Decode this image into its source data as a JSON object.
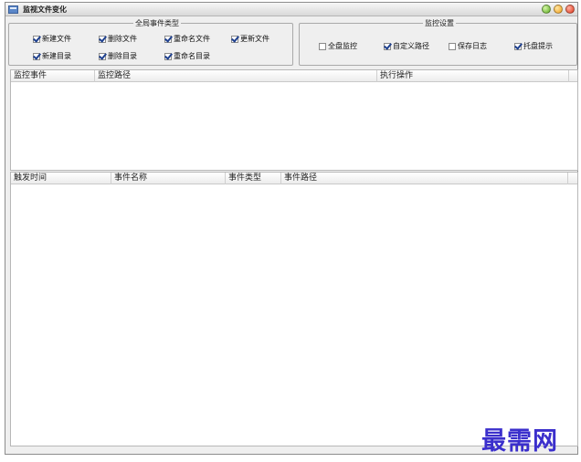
{
  "window": {
    "title": "监视文件变化",
    "accent": "#5b87c9"
  },
  "events_group": {
    "caption": "全局事件类型",
    "options": [
      {
        "label": "新建文件",
        "checked": true
      },
      {
        "label": "删除文件",
        "checked": true
      },
      {
        "label": "重命名文件",
        "checked": true
      },
      {
        "label": "更新文件",
        "checked": true
      },
      {
        "label": "新建目录",
        "checked": true
      },
      {
        "label": "删除目录",
        "checked": true
      },
      {
        "label": "重命名目录",
        "checked": true
      }
    ]
  },
  "settings_group": {
    "caption": "监控设置",
    "options": [
      {
        "label": "全盘监控",
        "checked": false
      },
      {
        "label": "自定义路径",
        "checked": true
      },
      {
        "label": "保存日志",
        "checked": false
      },
      {
        "label": "托盘提示",
        "checked": true
      }
    ]
  },
  "monitor_table": {
    "columns": [
      "监控事件",
      "监控路径",
      "执行操作"
    ],
    "rows": []
  },
  "log_table": {
    "columns": [
      "触发时间",
      "事件名称",
      "事件类型",
      "事件路径"
    ],
    "rows": []
  },
  "watermark": {
    "text": "最需网",
    "color": "#3b2fcc"
  }
}
